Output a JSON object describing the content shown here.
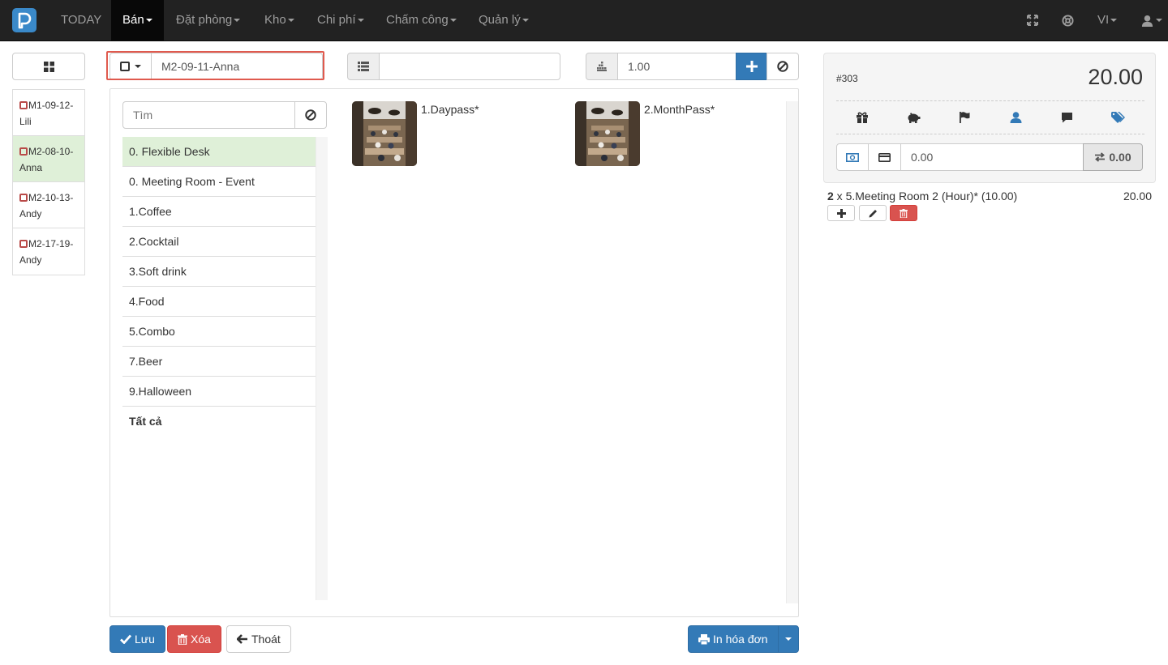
{
  "nav": {
    "items": [
      {
        "label": "TODAY",
        "dropdown": false,
        "active": false
      },
      {
        "label": "Bán",
        "dropdown": true,
        "active": true
      },
      {
        "label": "Đặt phòng",
        "dropdown": true,
        "active": false
      },
      {
        "label": "Kho",
        "dropdown": true,
        "active": false
      },
      {
        "label": "Chi phí",
        "dropdown": true,
        "active": false
      },
      {
        "label": "Chấm công",
        "dropdown": true,
        "active": false
      },
      {
        "label": "Quản lý",
        "dropdown": true,
        "active": false
      }
    ],
    "language": "VI",
    "icons": [
      "fullscreen-icon",
      "globe-icon",
      "user-icon"
    ]
  },
  "tables": [
    {
      "label": "M1-09-12-Lili",
      "active": false
    },
    {
      "label": "M2-08-10-Anna",
      "active": true
    },
    {
      "label": "M2-10-13-Andy",
      "active": false
    },
    {
      "label": "M2-17-19-Andy",
      "active": false
    }
  ],
  "toolbar": {
    "table_value": "M2-09-11-Anna",
    "barcode_value": "",
    "quantity_value": "1.00"
  },
  "search": {
    "placeholder": "Tìm"
  },
  "categories": [
    {
      "label": "0. Flexible Desk",
      "active": true
    },
    {
      "label": "0. Meeting Room - Event",
      "active": false
    },
    {
      "label": "1.Coffee",
      "active": false
    },
    {
      "label": "2.Cocktail",
      "active": false
    },
    {
      "label": "3.Soft drink",
      "active": false
    },
    {
      "label": "4.Food",
      "active": false
    },
    {
      "label": "5.Combo",
      "active": false
    },
    {
      "label": "7.Beer",
      "active": false
    },
    {
      "label": "9.Halloween",
      "active": false
    },
    {
      "label": "Tất cả",
      "active": false,
      "bold": true
    }
  ],
  "products": [
    {
      "name": "1.Daypass*"
    },
    {
      "name": "2.MonthPass*"
    }
  ],
  "actions": {
    "save": "Lưu",
    "delete": "Xóa",
    "exit": "Thoát",
    "print": "In hóa đơn"
  },
  "order": {
    "number": "#303",
    "total": "20.00",
    "payment_value": "0.00",
    "change": "0.00",
    "lines": [
      {
        "qty": "2",
        "text": " x 5.Meeting Room 2 (Hour)* (10.00)",
        "amount": "20.00"
      }
    ]
  },
  "colors": {
    "navbar": "#222222",
    "primary": "#337ab7",
    "danger": "#d9534f",
    "active_row": "#dff0d8",
    "highlight": "#e05a4e"
  }
}
